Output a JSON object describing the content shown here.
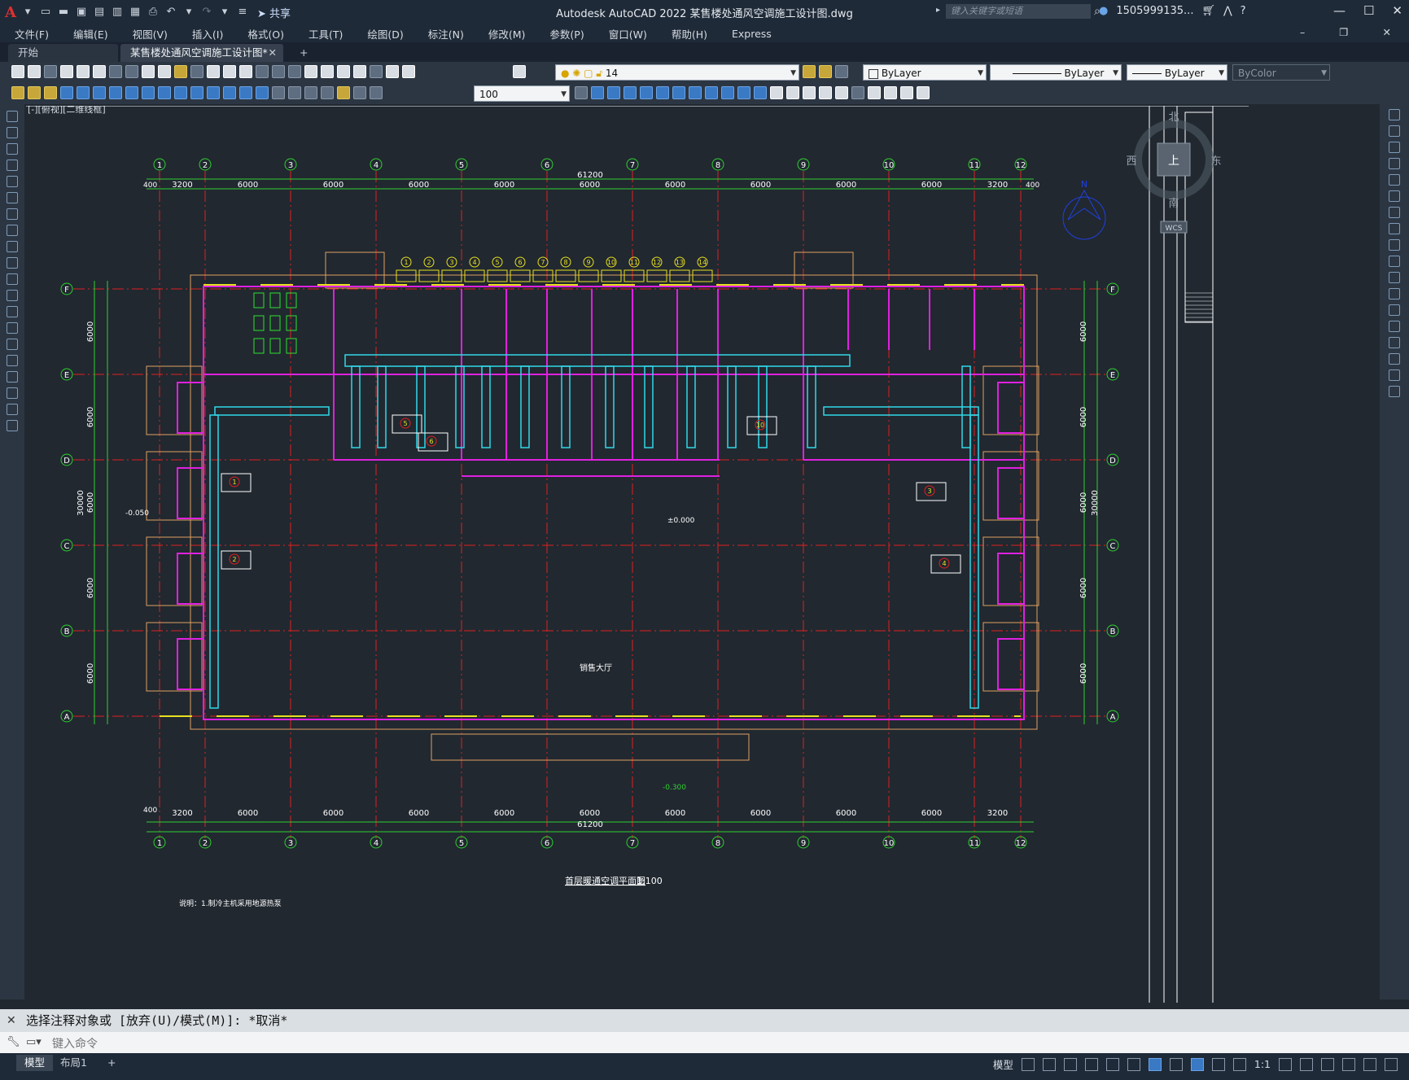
{
  "app": {
    "title": "Autodesk AutoCAD 2022    某售楼处通风空调施工设计图.dwg",
    "share_label": "共享",
    "search_placeholder": "键入关键字或短语",
    "user": "1505999135...",
    "logo": "A"
  },
  "menu": [
    "文件(F)",
    "编辑(E)",
    "视图(V)",
    "插入(I)",
    "格式(O)",
    "工具(T)",
    "绘图(D)",
    "标注(N)",
    "修改(M)",
    "参数(P)",
    "窗口(W)",
    "帮助(H)",
    "Express"
  ],
  "tabs": {
    "start": "开始",
    "document": "某售楼处通风空调施工设计图*",
    "close": "✕",
    "add": "+"
  },
  "toolbar": {
    "layer_value": "14",
    "color_value": "ByLayer",
    "linetype_value": "ByLayer",
    "lineweight_value": "ByLayer",
    "plotstyle_value": "ByColor",
    "scale_value": "100"
  },
  "viewcube": {
    "north": "北",
    "south": "南",
    "east": "东",
    "west": "西",
    "top": "上",
    "ucs": "WCS"
  },
  "drawing": {
    "viewport_label": "[-][俯视][二维线框]",
    "total_width": "61200",
    "total_depth": "30000",
    "bay_spacing": [
      "3200",
      "6000",
      "6000",
      "6000",
      "6000",
      "6000",
      "6000",
      "6000",
      "6000",
      "6000",
      "3200"
    ],
    "bay_depths": [
      "6000",
      "6000",
      "6000",
      "6000",
      "6000"
    ],
    "col_axes": [
      "1",
      "2",
      "3",
      "4",
      "5",
      "6",
      "7",
      "8",
      "9",
      "10",
      "11",
      "12"
    ],
    "row_axes": [
      "F",
      "E",
      "D",
      "C",
      "B",
      "A"
    ],
    "offset": "400",
    "elev_top": "±0.000",
    "elev_left": "-0.050",
    "elev_bottom": "-0.300",
    "hall_label": "销售大厅",
    "compass_n": "N",
    "caption": "首层暖通空调平面图",
    "caption_scale": "1:100",
    "note": "说明：1.制冷主机采用地源热泵"
  },
  "command": {
    "history": "选择注释对象或 [放弃(U)/模式(M)]: *取消*",
    "placeholder": "键入命令"
  },
  "layout_tabs": {
    "model": "模型",
    "layout1": "布局1",
    "add": "+"
  },
  "status": {
    "model": "模型",
    "scale": "1:1"
  }
}
